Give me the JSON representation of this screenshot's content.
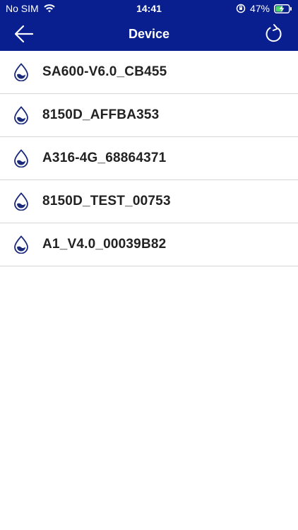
{
  "status_bar": {
    "carrier": "No SIM",
    "time": "14:41",
    "battery": "47%"
  },
  "nav": {
    "title": "Device",
    "back_icon": "back-arrow-icon",
    "refresh_icon": "refresh-icon"
  },
  "colors": {
    "header_bg": "#0a1f8f",
    "drop_icon": "#1a2a7a",
    "separator": "#d6d6d6"
  },
  "devices": [
    {
      "name": "SA600-V6.0_CB455"
    },
    {
      "name": "8150D_AFFBA353"
    },
    {
      "name": "A316-4G_68864371"
    },
    {
      "name": "8150D_TEST_00753"
    },
    {
      "name": "A1_V4.0_00039B82"
    }
  ]
}
